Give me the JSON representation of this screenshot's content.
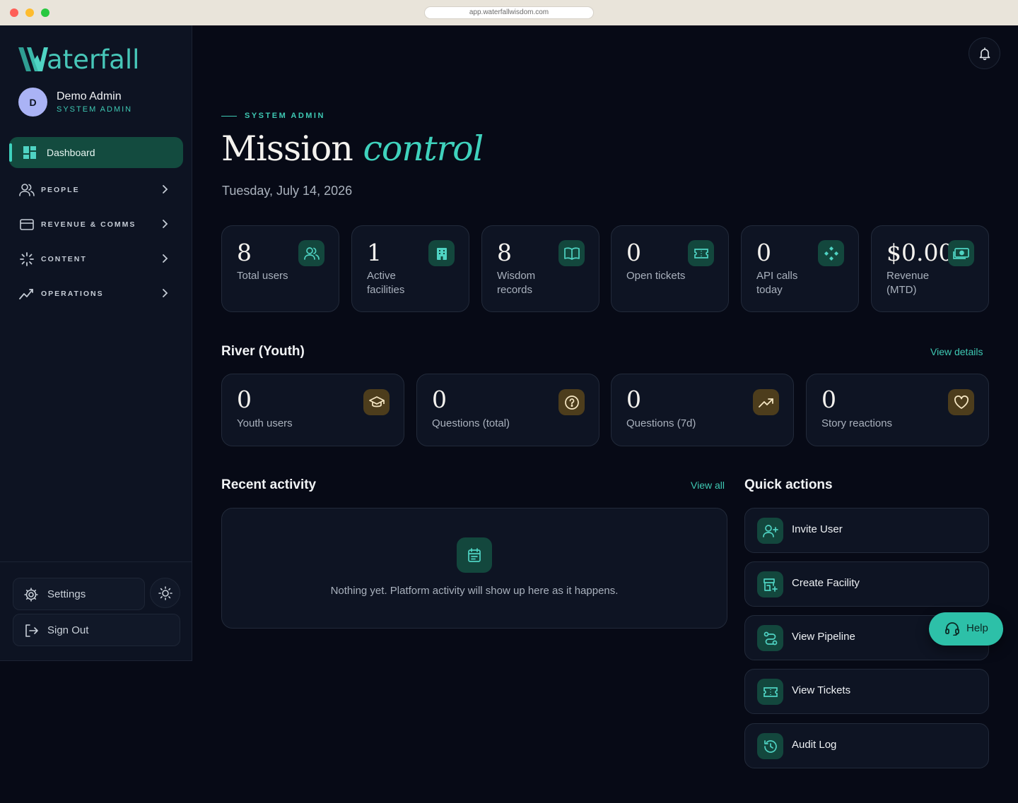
{
  "browser": {
    "url": "app.waterfallwisdom.com"
  },
  "brand": {
    "logo_letter": "W",
    "logo_rest": "aterfall"
  },
  "user": {
    "initial": "D",
    "name": "Demo Admin",
    "role": "SYSTEM ADMIN"
  },
  "nav": {
    "active_label": "Dashboard",
    "items": [
      {
        "label": "PEOPLE"
      },
      {
        "label": "REVENUE & COMMS"
      },
      {
        "label": "CONTENT"
      },
      {
        "label": "OPERATIONS"
      }
    ]
  },
  "footer": {
    "settings_label": "Settings",
    "signout_label": "Sign Out"
  },
  "header": {
    "eyebrow": "SYSTEM ADMIN",
    "title_main": "Mission",
    "title_accent": "control",
    "date": "Tuesday, July 14, 2026"
  },
  "stats": [
    {
      "value": "8",
      "label": "Total users",
      "icon": "users-icon"
    },
    {
      "value": "1",
      "label": "Active facilities",
      "icon": "building-icon"
    },
    {
      "value": "8",
      "label": "Wisdom records",
      "icon": "book-icon"
    },
    {
      "value": "0",
      "label": "Open tickets",
      "icon": "ticket-icon"
    },
    {
      "value": "0",
      "label": "API calls today",
      "icon": "diamond-icon"
    },
    {
      "value": "$0.00",
      "label": "Revenue (MTD)",
      "icon": "cash-icon"
    }
  ],
  "youth": {
    "title": "River (Youth)",
    "link": "View details",
    "stats": [
      {
        "value": "0",
        "label": "Youth users",
        "icon": "graduation-cap-icon"
      },
      {
        "value": "0",
        "label": "Questions (total)",
        "icon": "question-icon"
      },
      {
        "value": "0",
        "label": "Questions (7d)",
        "icon": "trending-up-icon"
      },
      {
        "value": "0",
        "label": "Story reactions",
        "icon": "heart-icon"
      }
    ]
  },
  "activity": {
    "title": "Recent activity",
    "link": "View all",
    "empty_message": "Nothing yet. Platform activity will show up here as it happens."
  },
  "quick_actions": {
    "title": "Quick actions",
    "items": [
      {
        "label": "Invite User",
        "icon": "user-plus-icon"
      },
      {
        "label": "Create Facility",
        "icon": "store-plus-icon"
      },
      {
        "label": "View Pipeline",
        "icon": "route-icon"
      },
      {
        "label": "View Tickets",
        "icon": "ticket-icon"
      },
      {
        "label": "Audit Log",
        "icon": "history-icon"
      }
    ]
  },
  "help": {
    "label": "Help"
  },
  "colors": {
    "accent": "#3ec8b3",
    "background": "#070a16",
    "card": "#0e1423",
    "icon_bg": "#13473d",
    "youth_icon_bg": "#4d3d1c"
  }
}
